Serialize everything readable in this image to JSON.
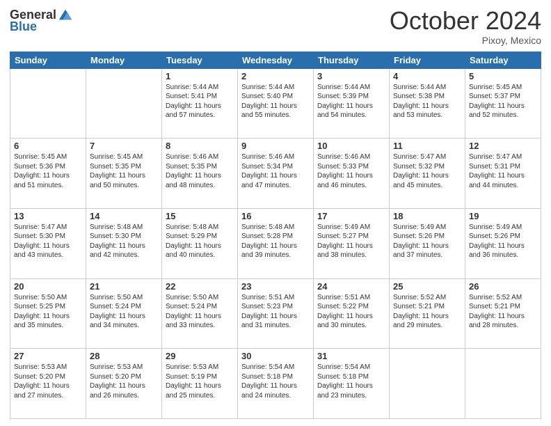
{
  "header": {
    "logo_general": "General",
    "logo_blue": "Blue",
    "month_title": "October 2024",
    "location": "Pixoy, Mexico"
  },
  "days_of_week": [
    "Sunday",
    "Monday",
    "Tuesday",
    "Wednesday",
    "Thursday",
    "Friday",
    "Saturday"
  ],
  "weeks": [
    [
      {
        "day": "",
        "sunrise": "",
        "sunset": "",
        "daylight": ""
      },
      {
        "day": "",
        "sunrise": "",
        "sunset": "",
        "daylight": ""
      },
      {
        "day": "1",
        "sunrise": "Sunrise: 5:44 AM",
        "sunset": "Sunset: 5:41 PM",
        "daylight": "Daylight: 11 hours and 57 minutes."
      },
      {
        "day": "2",
        "sunrise": "Sunrise: 5:44 AM",
        "sunset": "Sunset: 5:40 PM",
        "daylight": "Daylight: 11 hours and 55 minutes."
      },
      {
        "day": "3",
        "sunrise": "Sunrise: 5:44 AM",
        "sunset": "Sunset: 5:39 PM",
        "daylight": "Daylight: 11 hours and 54 minutes."
      },
      {
        "day": "4",
        "sunrise": "Sunrise: 5:44 AM",
        "sunset": "Sunset: 5:38 PM",
        "daylight": "Daylight: 11 hours and 53 minutes."
      },
      {
        "day": "5",
        "sunrise": "Sunrise: 5:45 AM",
        "sunset": "Sunset: 5:37 PM",
        "daylight": "Daylight: 11 hours and 52 minutes."
      }
    ],
    [
      {
        "day": "6",
        "sunrise": "Sunrise: 5:45 AM",
        "sunset": "Sunset: 5:36 PM",
        "daylight": "Daylight: 11 hours and 51 minutes."
      },
      {
        "day": "7",
        "sunrise": "Sunrise: 5:45 AM",
        "sunset": "Sunset: 5:35 PM",
        "daylight": "Daylight: 11 hours and 50 minutes."
      },
      {
        "day": "8",
        "sunrise": "Sunrise: 5:46 AM",
        "sunset": "Sunset: 5:35 PM",
        "daylight": "Daylight: 11 hours and 48 minutes."
      },
      {
        "day": "9",
        "sunrise": "Sunrise: 5:46 AM",
        "sunset": "Sunset: 5:34 PM",
        "daylight": "Daylight: 11 hours and 47 minutes."
      },
      {
        "day": "10",
        "sunrise": "Sunrise: 5:46 AM",
        "sunset": "Sunset: 5:33 PM",
        "daylight": "Daylight: 11 hours and 46 minutes."
      },
      {
        "day": "11",
        "sunrise": "Sunrise: 5:47 AM",
        "sunset": "Sunset: 5:32 PM",
        "daylight": "Daylight: 11 hours and 45 minutes."
      },
      {
        "day": "12",
        "sunrise": "Sunrise: 5:47 AM",
        "sunset": "Sunset: 5:31 PM",
        "daylight": "Daylight: 11 hours and 44 minutes."
      }
    ],
    [
      {
        "day": "13",
        "sunrise": "Sunrise: 5:47 AM",
        "sunset": "Sunset: 5:30 PM",
        "daylight": "Daylight: 11 hours and 43 minutes."
      },
      {
        "day": "14",
        "sunrise": "Sunrise: 5:48 AM",
        "sunset": "Sunset: 5:30 PM",
        "daylight": "Daylight: 11 hours and 42 minutes."
      },
      {
        "day": "15",
        "sunrise": "Sunrise: 5:48 AM",
        "sunset": "Sunset: 5:29 PM",
        "daylight": "Daylight: 11 hours and 40 minutes."
      },
      {
        "day": "16",
        "sunrise": "Sunrise: 5:48 AM",
        "sunset": "Sunset: 5:28 PM",
        "daylight": "Daylight: 11 hours and 39 minutes."
      },
      {
        "day": "17",
        "sunrise": "Sunrise: 5:49 AM",
        "sunset": "Sunset: 5:27 PM",
        "daylight": "Daylight: 11 hours and 38 minutes."
      },
      {
        "day": "18",
        "sunrise": "Sunrise: 5:49 AM",
        "sunset": "Sunset: 5:26 PM",
        "daylight": "Daylight: 11 hours and 37 minutes."
      },
      {
        "day": "19",
        "sunrise": "Sunrise: 5:49 AM",
        "sunset": "Sunset: 5:26 PM",
        "daylight": "Daylight: 11 hours and 36 minutes."
      }
    ],
    [
      {
        "day": "20",
        "sunrise": "Sunrise: 5:50 AM",
        "sunset": "Sunset: 5:25 PM",
        "daylight": "Daylight: 11 hours and 35 minutes."
      },
      {
        "day": "21",
        "sunrise": "Sunrise: 5:50 AM",
        "sunset": "Sunset: 5:24 PM",
        "daylight": "Daylight: 11 hours and 34 minutes."
      },
      {
        "day": "22",
        "sunrise": "Sunrise: 5:50 AM",
        "sunset": "Sunset: 5:24 PM",
        "daylight": "Daylight: 11 hours and 33 minutes."
      },
      {
        "day": "23",
        "sunrise": "Sunrise: 5:51 AM",
        "sunset": "Sunset: 5:23 PM",
        "daylight": "Daylight: 11 hours and 31 minutes."
      },
      {
        "day": "24",
        "sunrise": "Sunrise: 5:51 AM",
        "sunset": "Sunset: 5:22 PM",
        "daylight": "Daylight: 11 hours and 30 minutes."
      },
      {
        "day": "25",
        "sunrise": "Sunrise: 5:52 AM",
        "sunset": "Sunset: 5:21 PM",
        "daylight": "Daylight: 11 hours and 29 minutes."
      },
      {
        "day": "26",
        "sunrise": "Sunrise: 5:52 AM",
        "sunset": "Sunset: 5:21 PM",
        "daylight": "Daylight: 11 hours and 28 minutes."
      }
    ],
    [
      {
        "day": "27",
        "sunrise": "Sunrise: 5:53 AM",
        "sunset": "Sunset: 5:20 PM",
        "daylight": "Daylight: 11 hours and 27 minutes."
      },
      {
        "day": "28",
        "sunrise": "Sunrise: 5:53 AM",
        "sunset": "Sunset: 5:20 PM",
        "daylight": "Daylight: 11 hours and 26 minutes."
      },
      {
        "day": "29",
        "sunrise": "Sunrise: 5:53 AM",
        "sunset": "Sunset: 5:19 PM",
        "daylight": "Daylight: 11 hours and 25 minutes."
      },
      {
        "day": "30",
        "sunrise": "Sunrise: 5:54 AM",
        "sunset": "Sunset: 5:18 PM",
        "daylight": "Daylight: 11 hours and 24 minutes."
      },
      {
        "day": "31",
        "sunrise": "Sunrise: 5:54 AM",
        "sunset": "Sunset: 5:18 PM",
        "daylight": "Daylight: 11 hours and 23 minutes."
      },
      {
        "day": "",
        "sunrise": "",
        "sunset": "",
        "daylight": ""
      },
      {
        "day": "",
        "sunrise": "",
        "sunset": "",
        "daylight": ""
      }
    ]
  ]
}
